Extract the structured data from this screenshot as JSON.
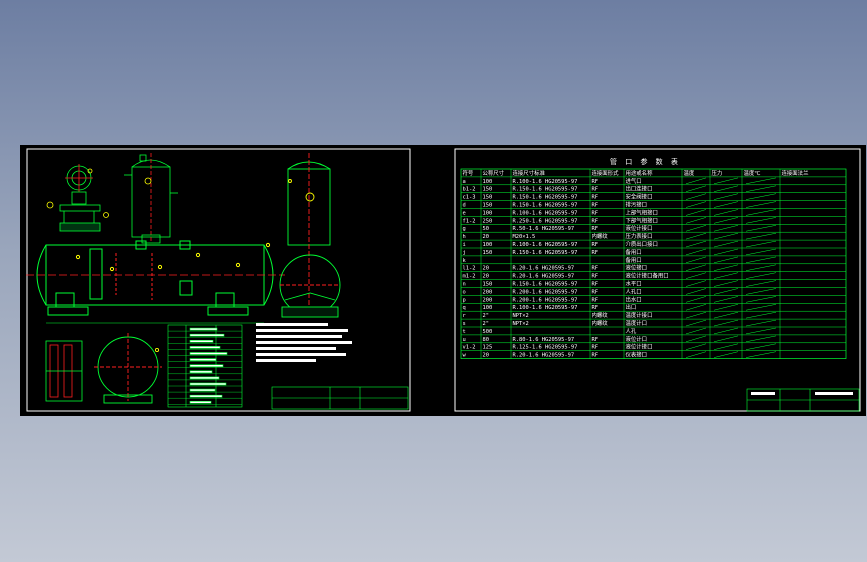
{
  "colors": {
    "background_top": "#6d7ea2",
    "background_bottom": "#c3c9d5",
    "viewport": "#000000",
    "frame": "#ffffff",
    "table": "#00ff33",
    "vessel": "#00ff33",
    "centerline": "#ff2020",
    "nozzle_mark": "#ffff00",
    "text": "#ffffff"
  },
  "nozzle_table": {
    "title": "管 口 参 数 表",
    "headers": [
      "符号",
      "公称尺寸",
      "连接尺寸标准",
      "连接面形式",
      "用途或名称",
      "温度",
      "压力",
      "温度℃",
      "连接面法兰"
    ],
    "rows": [
      [
        "a",
        "100",
        "R.100-1.6 HG20595-97",
        "RF",
        "进气口"
      ],
      [
        "b1-2",
        "150",
        "R.150-1.6 HG20595-97",
        "RF",
        "出口连接口"
      ],
      [
        "c1-3",
        "150",
        "R.150-1.6 HG20595-97",
        "RF",
        "安全阀接口"
      ],
      [
        "d",
        "150",
        "R.150-1.6 HG20595-97",
        "RF",
        "排污接口"
      ],
      [
        "e",
        "100",
        "R.100-1.6 HG20595-97",
        "RF",
        "上部气相接口"
      ],
      [
        "f1-2",
        "250",
        "R.250-1.6 HG20595-97",
        "RF",
        "下部气相接口"
      ],
      [
        "g",
        "50",
        "R.50-1.6 HG20595-97",
        "RF",
        "液位计接口"
      ],
      [
        "h",
        "20",
        "M20×1.5",
        "内螺纹",
        "压力表接口"
      ],
      [
        "i",
        "100",
        "R.100-1.6 HG20595-97",
        "RF",
        "介质出口接口"
      ],
      [
        "j",
        "150",
        "R.150-1.6 HG20595-97",
        "RF",
        "备用口"
      ],
      [
        "k",
        "",
        "",
        "",
        "备用口"
      ],
      [
        "l1-2",
        "20",
        "R.20-1.6 HG20595-97",
        "RF",
        "液位接口"
      ],
      [
        "m1-2",
        "20",
        "R.20-1.6 HG20595-97",
        "RF",
        "液位计接口备用口"
      ],
      [
        "n",
        "150",
        "R.150-1.6 HG20595-97",
        "RF",
        "水平口"
      ],
      [
        "o",
        "200",
        "R.200-1.6 HG20595-97",
        "RF",
        "人孔口"
      ],
      [
        "p",
        "200",
        "R.200-1.6 HG20595-97",
        "RF",
        "出水口"
      ],
      [
        "q",
        "100",
        "R.100-1.6 HG20595-97",
        "RF",
        "出口"
      ],
      [
        "r",
        "2\"",
        "NPT×2",
        "内螺纹",
        "温度计接口"
      ],
      [
        "s",
        "2\"",
        "NPT×2",
        "内螺纹",
        "温度计口"
      ],
      [
        "t",
        "500",
        "",
        "",
        "人孔"
      ],
      [
        "u",
        "80",
        "R.80-1.6 HG20595-97",
        "RF",
        "液位计口"
      ],
      [
        "v1-2",
        "125",
        "R.125-1.6 HG20595-97",
        "RF",
        "液位计接口"
      ],
      [
        "w",
        "20",
        "R.20-1.6 HG20595-97",
        "RF",
        "仪表接口"
      ]
    ]
  }
}
